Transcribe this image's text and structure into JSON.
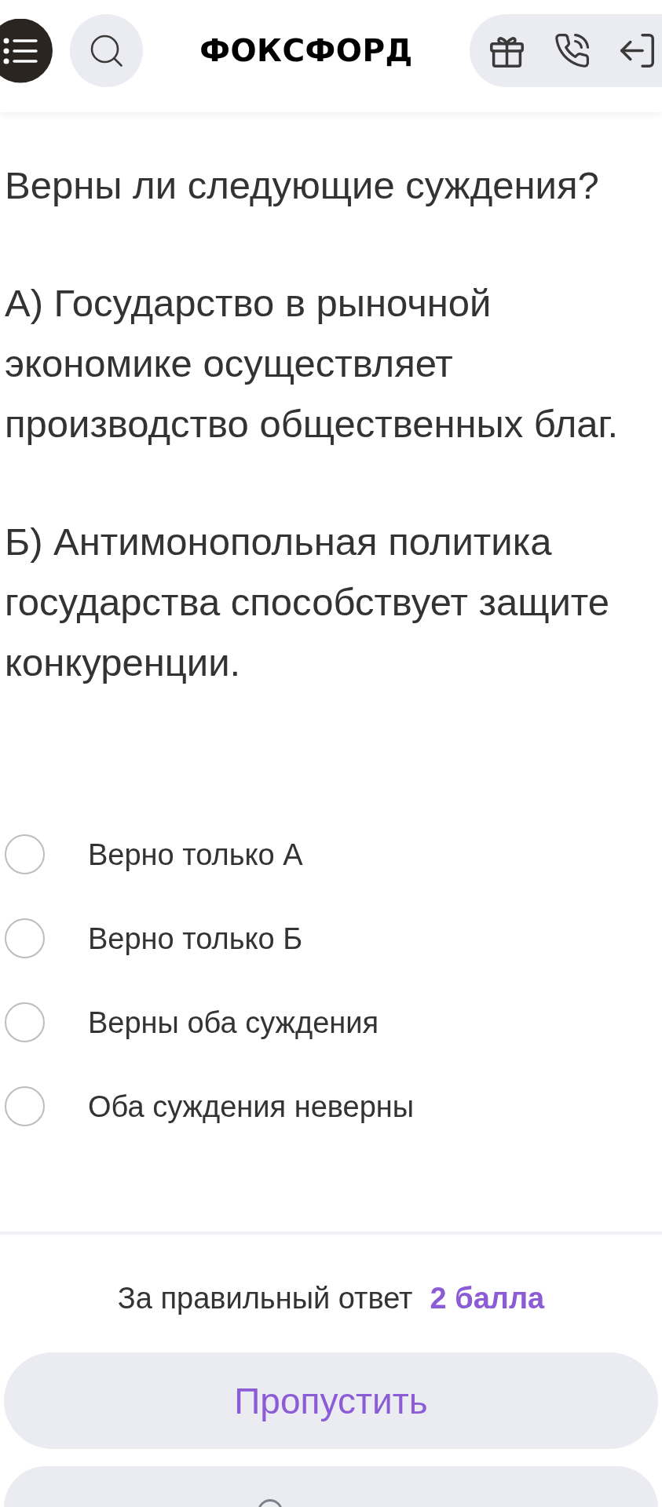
{
  "header": {
    "logo": "ФОКСФОРД"
  },
  "question": {
    "paragraphs": [
      "Верны ли следующие суждения?",
      "А) Государство в рыночной экономике осуществляет производство общественных благ.",
      "Б) Антимонопольная политика государства способствует защите конкуренции."
    ]
  },
  "options": [
    {
      "label": "Верно только А",
      "selected": false
    },
    {
      "label": "Верно только Б",
      "selected": false
    },
    {
      "label": "Верны оба суждения",
      "selected": false
    },
    {
      "label": "Оба суждения неверны",
      "selected": false
    }
  ],
  "score": {
    "label": "За правильный ответ",
    "value": "2 балла"
  },
  "skip_button": {
    "label": "Пропустить"
  }
}
